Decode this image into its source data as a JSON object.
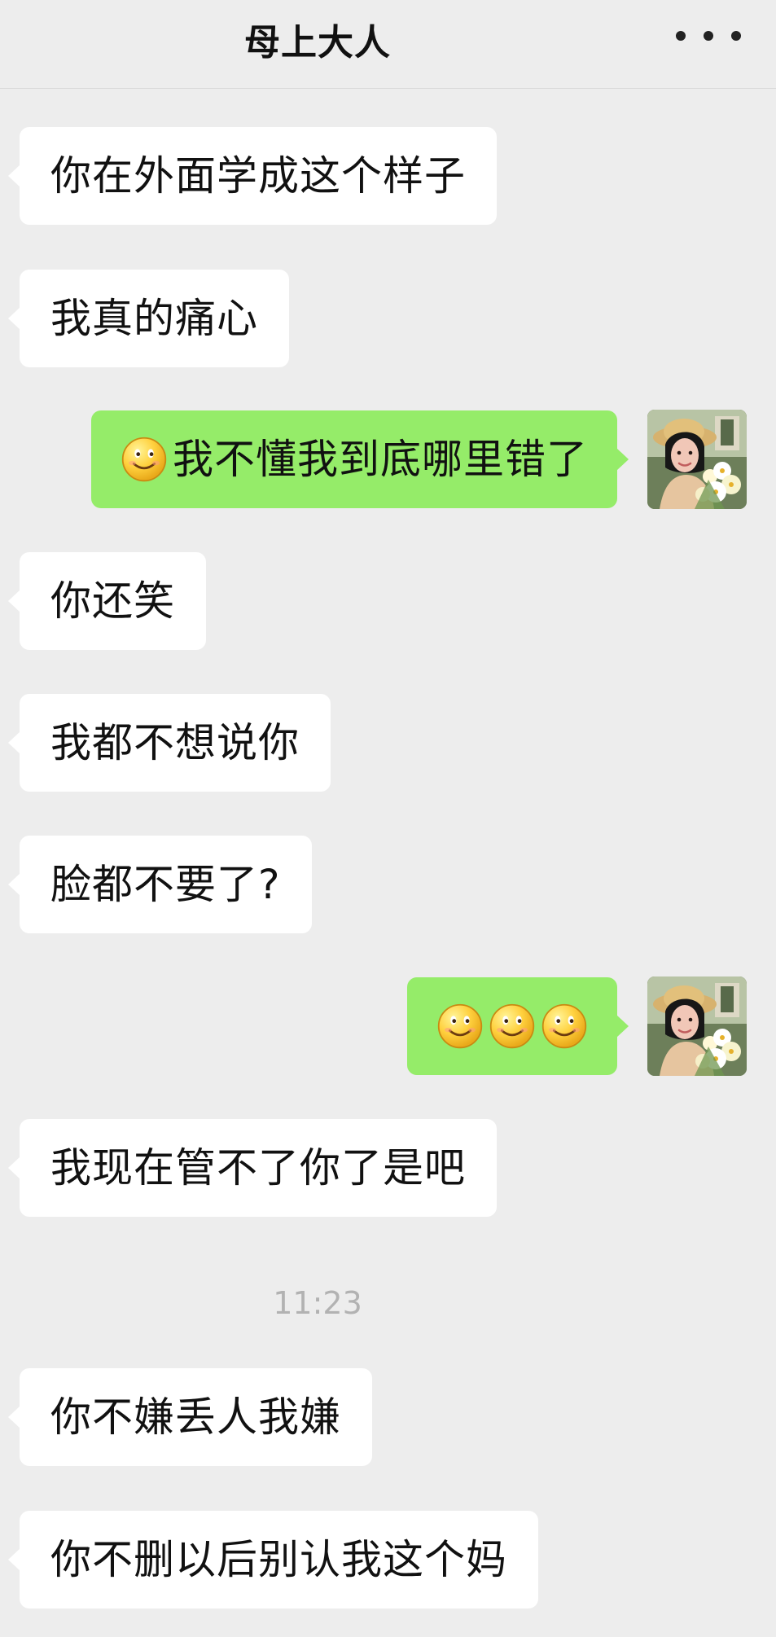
{
  "header": {
    "title": "母上大人"
  },
  "messages": [
    {
      "side": "left",
      "text": "你在外面学成这个样子"
    },
    {
      "side": "left",
      "text": "我真的痛心"
    },
    {
      "side": "right",
      "text": "我不懂我到底哪里错了",
      "emoji": [
        "smile-icon"
      ]
    },
    {
      "side": "left",
      "text": "你还笑"
    },
    {
      "side": "left",
      "text": "我都不想说你"
    },
    {
      "side": "left",
      "text": "脸都不要了?"
    },
    {
      "side": "right",
      "text": "",
      "emoji": [
        "smile-icon",
        "smile-icon",
        "smile-icon"
      ]
    },
    {
      "side": "left",
      "text": "我现在管不了你了是吧"
    },
    {
      "side": "left",
      "text": "你不嫌丢人我嫌"
    },
    {
      "side": "left",
      "text": "你不删以后别认我这个妈"
    }
  ],
  "timestamp": "11:23",
  "colors": {
    "background": "#ededed",
    "left_bubble": "#ffffff",
    "right_bubble": "#95ec69",
    "timestamp": "#b2b2b2"
  },
  "icons": {
    "more": "more-icon",
    "emoji": "smile-icon",
    "avatar": "profile-avatar"
  }
}
